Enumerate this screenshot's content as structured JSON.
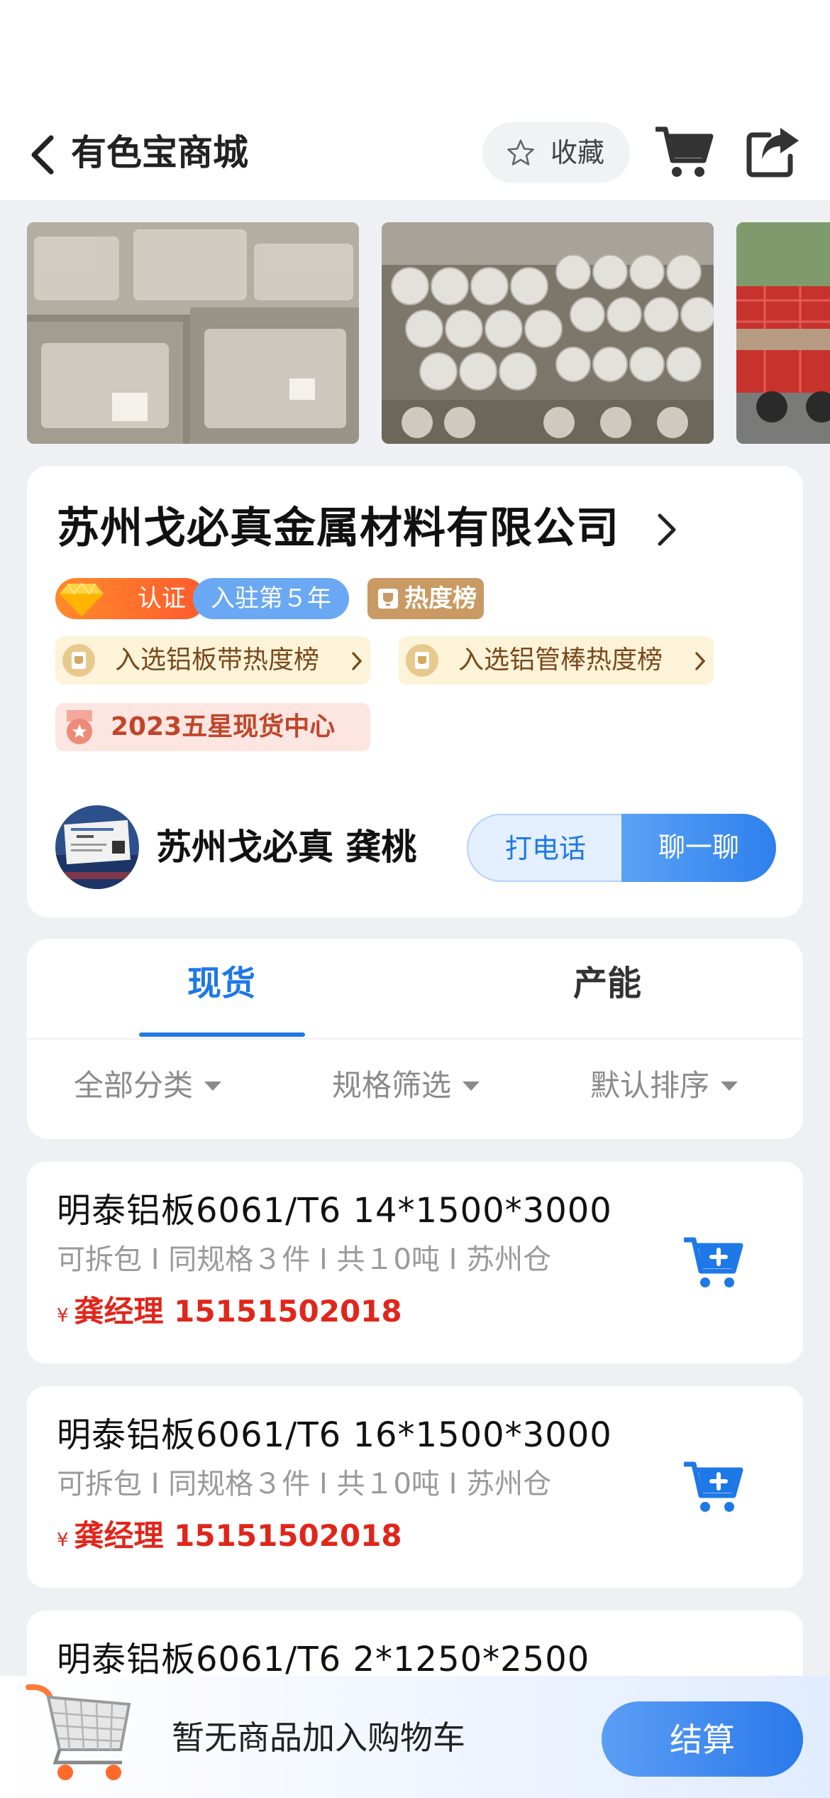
{
  "header": {
    "title": "有色宝商城",
    "favorite_label": "收藏"
  },
  "company": {
    "name": "苏州戈必真金属材料有限公司",
    "badges": {
      "certified": "认证",
      "years": "入驻第５年",
      "hot_rank": "热度榜"
    },
    "rankings": [
      {
        "label": "入选铝板带热度榜"
      },
      {
        "label": "入选铝管棒热度榜"
      }
    ],
    "star_center": "2023五星现货中心",
    "contact_name": "苏州戈必真 龚桃",
    "call_label": "打电话",
    "chat_label": "聊一聊"
  },
  "tabs": {
    "items": [
      {
        "label": "现货",
        "active": true
      },
      {
        "label": "产能",
        "active": false
      }
    ],
    "filters": [
      {
        "label": "全部分类"
      },
      {
        "label": "规格筛选"
      },
      {
        "label": "默认排序"
      }
    ]
  },
  "products": [
    {
      "name": "明泰铝板6061/T6 14*1500*3000",
      "meta": "可拆包 I 同规格３件 I 共１0吨 I 苏州仓",
      "currency": "¥",
      "price_text": "龚经理 15151502018"
    },
    {
      "name": "明泰铝板6061/T6 16*1500*3000",
      "meta": "可拆包 I 同规格３件 I 共１0吨 I 苏州仓",
      "currency": "¥",
      "price_text": "龚经理 15151502018"
    },
    {
      "name": "明泰铝板6061/T6 2*1250*2500",
      "meta": "",
      "currency": "",
      "price_text": ""
    }
  ],
  "bottom_bar": {
    "empty_text": "暂无商品加入购物车",
    "checkout_label": "结算"
  },
  "colors": {
    "accent": "#1e78e6",
    "price": "#e0261b",
    "background": "#eef0f4"
  },
  "icons": {
    "back": "chevron-left-icon",
    "favorite": "star-outline-icon",
    "cart": "cart-icon",
    "share": "share-icon",
    "add_to_cart": "cart-add-icon"
  }
}
